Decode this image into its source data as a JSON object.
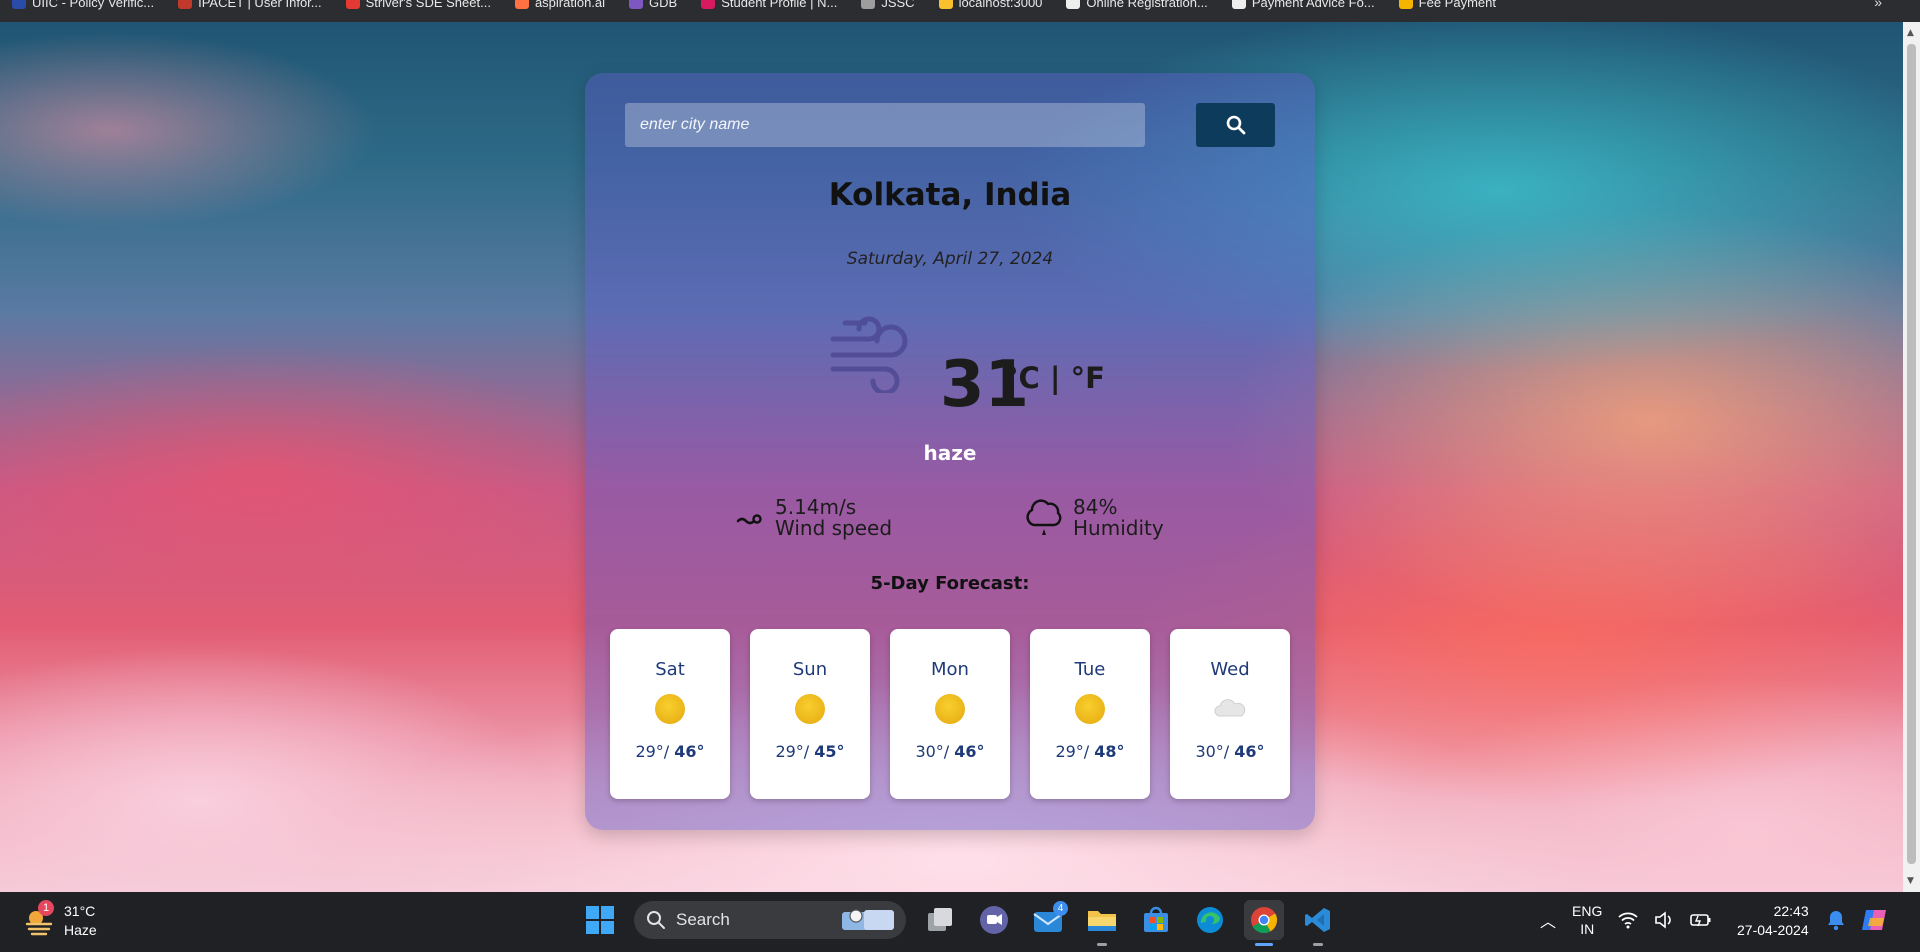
{
  "browser": {
    "bookmarks": [
      {
        "label": "UIIC - Policy Verific...",
        "icon": "uiic-icon",
        "color": "#2a4ba8"
      },
      {
        "label": "IPACET | User Infor...",
        "icon": "ipacet-icon",
        "color": "#c0392b"
      },
      {
        "label": "Striver's SDE Sheet...",
        "icon": "striver-icon",
        "color": "#e53935"
      },
      {
        "label": "aspiration.ai",
        "icon": "aspiration-icon",
        "color": "#ff7043"
      },
      {
        "label": "GDB",
        "icon": "gdb-icon",
        "color": "#7e57c2"
      },
      {
        "label": "Student Profile | N...",
        "icon": "student-profile-icon",
        "color": "#d81b60"
      },
      {
        "label": "JSSC",
        "icon": "jssc-icon",
        "color": "#9e9e9e"
      },
      {
        "label": "localhost:3000",
        "icon": "localhost-icon",
        "color": "#fbc02d"
      },
      {
        "label": "Online Registration...",
        "icon": "registration-icon",
        "color": "#eeeeee"
      },
      {
        "label": "Payment Advice Fo...",
        "icon": "payment-advice-icon",
        "color": "#eeeeee"
      },
      {
        "label": "Fee Payment",
        "icon": "fee-payment-icon",
        "color": "#f4b400"
      }
    ],
    "more_label": "»"
  },
  "weather": {
    "search_placeholder": "enter city name",
    "search_value": "",
    "city": "Kolkata, India",
    "date": "Saturday, April 27, 2024",
    "icon": "haze-wind-icon",
    "temperature": "31",
    "units": "°C | °F",
    "condition": "haze",
    "wind": {
      "value": "5.14m/s",
      "label": "Wind speed",
      "icon": "wind-icon"
    },
    "humidity": {
      "value": "84%",
      "label": "Humidity",
      "icon": "humidity-icon"
    },
    "forecast_title": "5-Day Forecast:",
    "forecast": [
      {
        "day": "Sat",
        "low": "29°/",
        "high": "46°",
        "icon": "sun-icon"
      },
      {
        "day": "Sun",
        "low": "29°/",
        "high": "45°",
        "icon": "sun-icon"
      },
      {
        "day": "Mon",
        "low": "30°/",
        "high": "46°",
        "icon": "sun-icon"
      },
      {
        "day": "Tue",
        "low": "29°/",
        "high": "48°",
        "icon": "sun-icon"
      },
      {
        "day": "Wed",
        "low": "30°/",
        "high": "46°",
        "icon": "cloud-icon"
      }
    ]
  },
  "taskbar": {
    "weather_temp": "31°C",
    "weather_cond": "Haze",
    "weather_badge": "1",
    "search_label": "Search",
    "mail_badge": "4",
    "lang_line1": "ENG",
    "lang_line2": "IN",
    "time": "22:43",
    "date": "27-04-2024"
  },
  "colors": {
    "search_button": "#0d3b5c",
    "forecast_text": "#1e3a78",
    "sun": "#f2bd1c",
    "card_overlay": "rgba(95,90,200,0.45)"
  }
}
